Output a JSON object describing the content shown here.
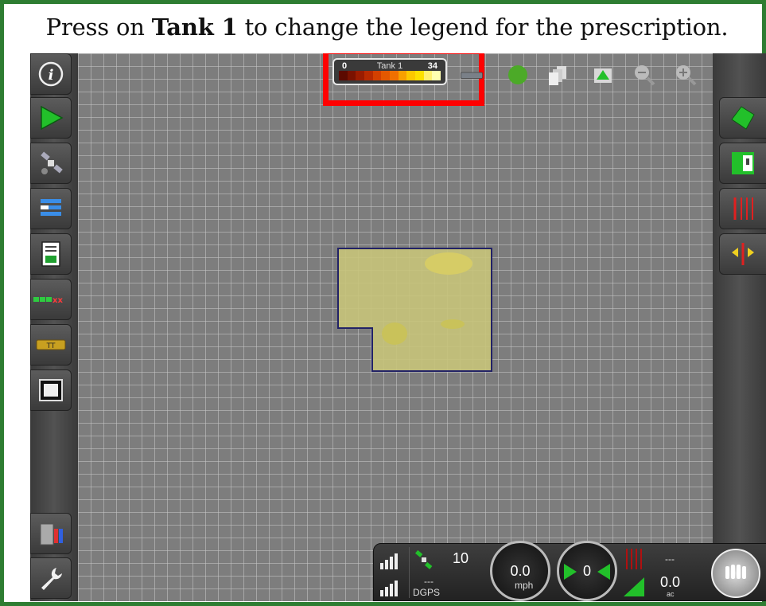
{
  "instruction": {
    "prefix": "Press on ",
    "bold": "Tank 1",
    "suffix": " to change the legend for the prescription."
  },
  "legend": {
    "min": "0",
    "title": "Tank 1",
    "max": "34",
    "gradient": [
      "#5c0a00",
      "#7a1200",
      "#9a1c00",
      "#b82a00",
      "#d44000",
      "#e45800",
      "#f07000",
      "#f8a000",
      "#fcc800",
      "#fde000",
      "#fff070",
      "#ffffb0"
    ]
  },
  "left_sidebar": {
    "items": [
      {
        "icon": "info-icon"
      },
      {
        "icon": "guidance-arrow-icon"
      },
      {
        "icon": "satellite-icon"
      },
      {
        "icon": "list-icon"
      },
      {
        "icon": "document-icon"
      },
      {
        "icon": "sections-icon"
      },
      {
        "icon": "implement-icon"
      },
      {
        "icon": "video-icon"
      },
      {
        "icon": "trash-icon"
      },
      {
        "icon": "wrench-icon"
      }
    ]
  },
  "right_sidebar": {
    "items": [
      {
        "icon": "field-boundary-icon"
      },
      {
        "icon": "split-view-icon"
      },
      {
        "icon": "guidance-lines-icon"
      },
      {
        "icon": "shift-line-icon"
      }
    ]
  },
  "top_icons": [
    "implement-view-icon",
    "globe-icon",
    "layers-icon",
    "field-view-icon",
    "zoom-out-icon",
    "zoom-in-icon"
  ],
  "status": {
    "satellites": "10",
    "signal_mode": "---",
    "gps_type": "DGPS",
    "speed": "0.0",
    "speed_unit": "mph",
    "guidance": "0",
    "rate_value": "---",
    "area": "0.0",
    "area_unit": "ac"
  }
}
